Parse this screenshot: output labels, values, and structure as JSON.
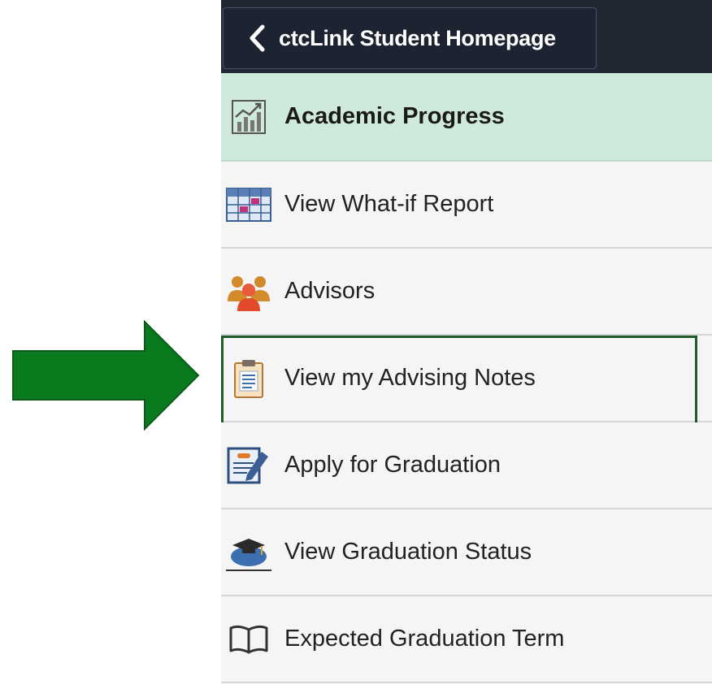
{
  "header": {
    "back_label": "ctcLink Student Homepage"
  },
  "menu": {
    "items": [
      {
        "label": "Academic Progress",
        "icon": "chart-icon",
        "selected": true
      },
      {
        "label": "View What-if Report",
        "icon": "report-grid-icon"
      },
      {
        "label": "Advisors",
        "icon": "people-icon"
      },
      {
        "label": "View my Advising Notes",
        "icon": "clipboard-icon",
        "highlighted": true
      },
      {
        "label": "Apply for Graduation",
        "icon": "application-form-icon"
      },
      {
        "label": "View Graduation Status",
        "icon": "graduation-cap-icon"
      },
      {
        "label": "Expected Graduation Term",
        "icon": "open-book-icon"
      }
    ]
  },
  "annotation": {
    "arrow_color": "#0a7a1e",
    "highlight_color": "#1f5a2a",
    "selected_bg": "#cfeada",
    "header_bg": "#1f2833"
  }
}
